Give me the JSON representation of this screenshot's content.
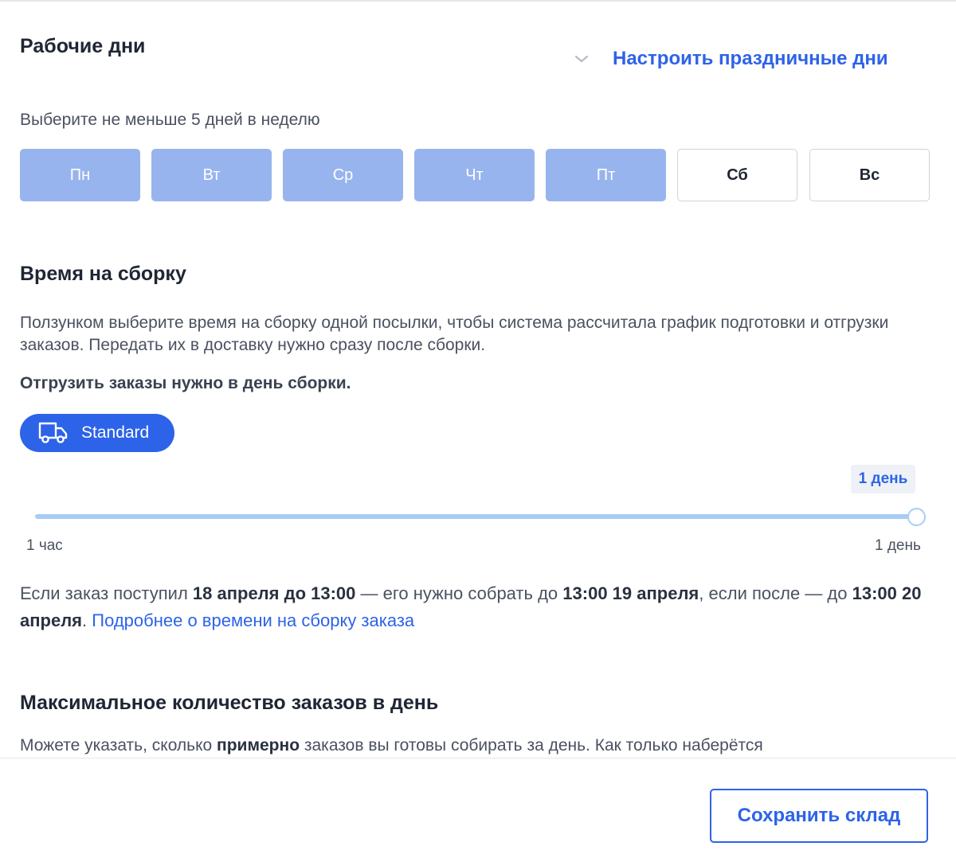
{
  "working_days": {
    "title": "Рабочие дни",
    "holiday_link": "Настроить праздничные дни",
    "hint": "Выберите не меньше 5 дней в неделю",
    "days": [
      {
        "label": "Пн",
        "selected": true
      },
      {
        "label": "Вт",
        "selected": true
      },
      {
        "label": "Ср",
        "selected": true
      },
      {
        "label": "Чт",
        "selected": true
      },
      {
        "label": "Пт",
        "selected": true
      },
      {
        "label": "Сб",
        "selected": false
      },
      {
        "label": "Вс",
        "selected": false
      }
    ]
  },
  "assembly": {
    "title": "Время на сборку",
    "description": "Ползунком выберите время на сборку одной посылки, чтобы система рассчитала график подготовки и отгрузки заказов. Передать их в доставку нужно сразу после сборки.",
    "ship_note": "Отгрузить заказы нужно в день сборки.",
    "badge": "Standard",
    "slider": {
      "value_label": "1 день",
      "min_label": "1 час",
      "max_label": "1 день",
      "fraction": 1.0
    },
    "info": {
      "p1": "Если заказ поступил ",
      "b1": "18 апреля до 13:00",
      "p2": " — его нужно собрать до ",
      "b2": "13:00 19 апреля",
      "p3": ", если после — до ",
      "b3": "13:00 20 апреля",
      "p4": ". ",
      "link": "Подробнее о времени на сборку заказа"
    }
  },
  "max_orders": {
    "title": "Максимальное количество заказов в день",
    "p1": "Можете указать, сколько ",
    "b1": "примерно",
    "p2": " заказов вы готовы собирать за день. Как только наберётся"
  },
  "footer": {
    "save_label": "Сохранить склад"
  },
  "colors": {
    "accent": "#2d63e8",
    "day_selected": "#98b4ee",
    "slider": "#a8cdf5"
  }
}
